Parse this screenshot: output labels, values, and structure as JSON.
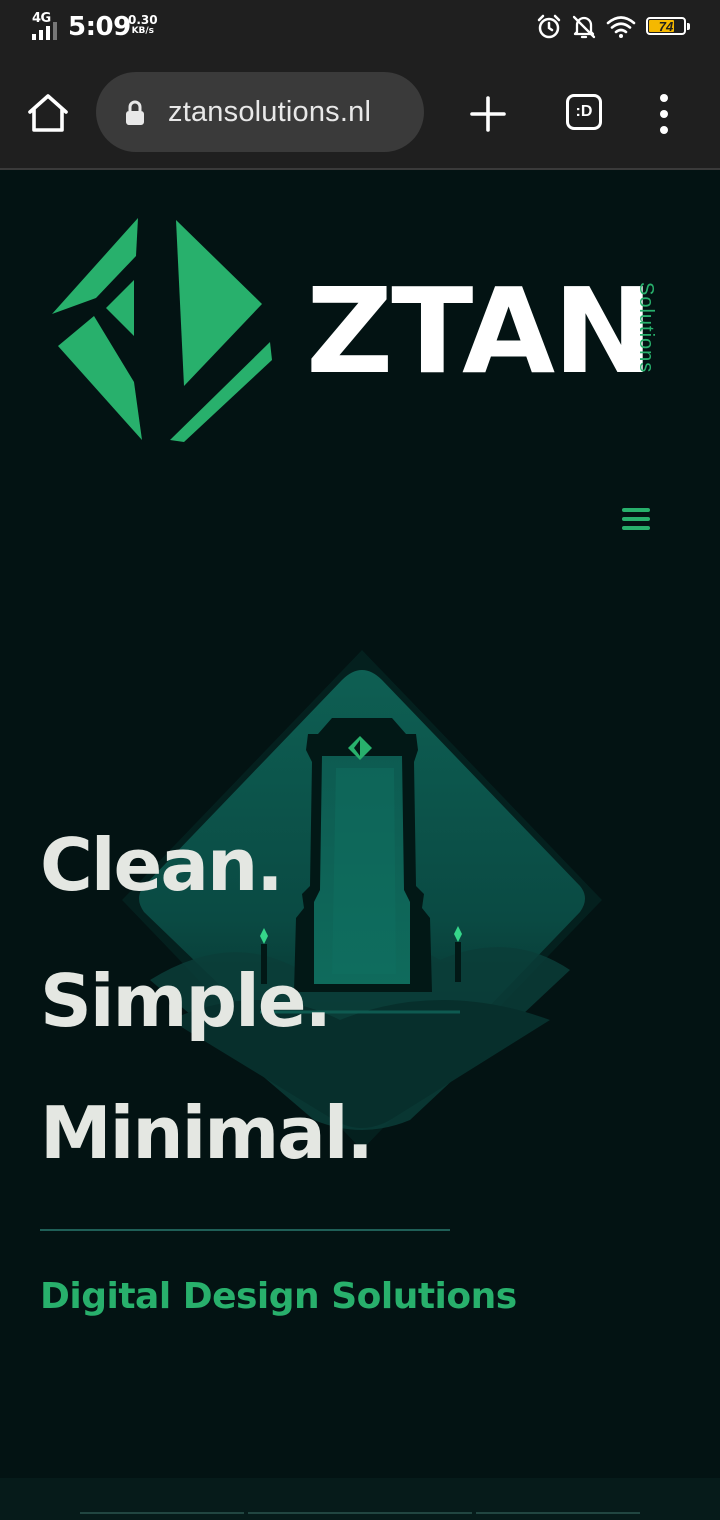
{
  "status_bar": {
    "network": "4G",
    "time": "5:09",
    "speed_value": "0.30",
    "speed_unit": "KB/s",
    "icons": [
      "alarm-icon",
      "notifications-off-icon",
      "wifi-icon",
      "battery-icon"
    ],
    "battery_level": "74",
    "battery_color": "#f5b800"
  },
  "browser": {
    "url": "ztansolutions.nl",
    "tabs_label": ":D",
    "icons": [
      "home-icon",
      "lock-icon",
      "plus-icon",
      "tabs-icon",
      "more-vert-icon"
    ]
  },
  "site": {
    "brand": {
      "name": "ZTAN",
      "sub": "Solutions"
    },
    "menu_icon": "hamburger-icon",
    "hero": {
      "lines": [
        "Clean.",
        "Simple.",
        "Minimal."
      ],
      "tagline": "Digital Design Solutions"
    },
    "colors": {
      "background": "#031313",
      "accent": "#28b06c",
      "headline": "#e4e7e2"
    }
  }
}
